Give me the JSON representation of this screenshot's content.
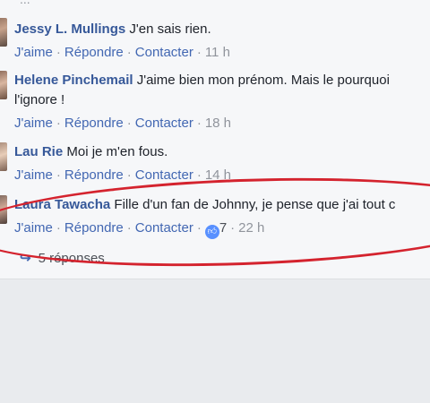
{
  "top_partial": "...",
  "comments": [
    {
      "author": "Jessy L. Mullings",
      "text": " J'en sais rien.",
      "actions": {
        "like": "J'aime",
        "reply": "Répondre",
        "contact": "Contacter",
        "time": "11 h"
      }
    },
    {
      "author": "Helene Pinchemail",
      "text": " J'aime bien mon prénom. Mais le pourquoi",
      "text2": "l'ignore !",
      "actions": {
        "like": "J'aime",
        "reply": "Répondre",
        "contact": "Contacter",
        "time": "18 h"
      }
    },
    {
      "author": "Lau Rie",
      "text": " Moi je m'en fous.",
      "actions": {
        "like": "J'aime",
        "reply": "Répondre",
        "contact": "Contacter",
        "time": "14 h"
      }
    },
    {
      "author": "Laura Tawacha",
      "text": " Fille d'un fan de Johnny, je pense que j'ai tout c",
      "actions": {
        "like": "J'aime",
        "reply": "Répondre",
        "contact": "Contacter",
        "likes": "7",
        "time": "22 h"
      }
    }
  ],
  "replies": {
    "label": "5 réponses"
  },
  "annotation_color": "#d4232e"
}
